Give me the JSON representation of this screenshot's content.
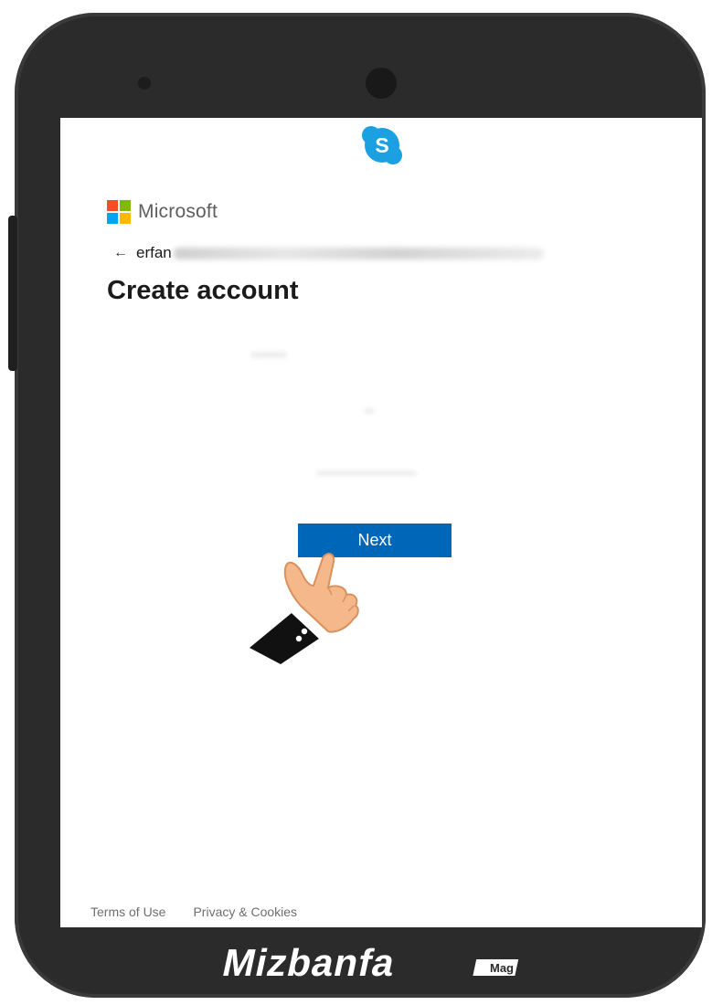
{
  "brand": {
    "company": "Microsoft",
    "app_icon": "skype-icon",
    "app_letter": "S",
    "app_color": "#1ba1e2",
    "ms_colors": [
      "#f25022",
      "#7fba00",
      "#00a4ef",
      "#ffb900"
    ]
  },
  "identity": {
    "back_icon": "arrow-left-icon",
    "back_glyph": "←",
    "visible_name": "erfan"
  },
  "page": {
    "title": "Create account"
  },
  "actions": {
    "next_label": "Next",
    "primary_color": "#0067b8"
  },
  "footer": {
    "terms": "Terms of Use",
    "privacy": "Privacy & Cookies"
  },
  "watermark": {
    "text": "Mizbanfa",
    "tag": "Mag"
  }
}
